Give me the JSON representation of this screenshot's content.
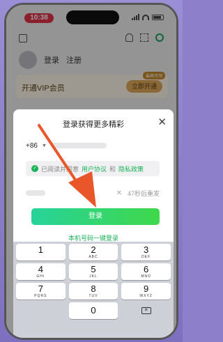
{
  "status": {
    "time": "10:38"
  },
  "user": {
    "login": "登录",
    "register": "注册"
  },
  "vip": {
    "label": "开通VIP会员",
    "badge": "最高可领",
    "button": "立即开通"
  },
  "modal": {
    "title": "登录获得更多精彩",
    "close": "✕",
    "country_code": "+86",
    "agree_prefix": "已阅读并同意",
    "agree_link1": "用户协议",
    "agree_and": "和",
    "agree_link2": "隐私政策",
    "resend": "47秒后重发",
    "login_button": "登录",
    "one_key_login": "本机号码一键登录"
  },
  "keypad": [
    {
      "digit": "1",
      "letters": ""
    },
    {
      "digit": "2",
      "letters": "ABC"
    },
    {
      "digit": "3",
      "letters": "DEF"
    },
    {
      "digit": "4",
      "letters": "GHI"
    },
    {
      "digit": "5",
      "letters": "JKL"
    },
    {
      "digit": "6",
      "letters": "MNO"
    },
    {
      "digit": "7",
      "letters": "PQRS"
    },
    {
      "digit": "8",
      "letters": "TUV"
    },
    {
      "digit": "9",
      "letters": "WXYZ"
    },
    {
      "digit": "0",
      "letters": ""
    }
  ],
  "colors": {
    "accent_green": "#1ab25a",
    "annotation_arrow": "#e8562a",
    "status_pill": "#e2334a"
  }
}
